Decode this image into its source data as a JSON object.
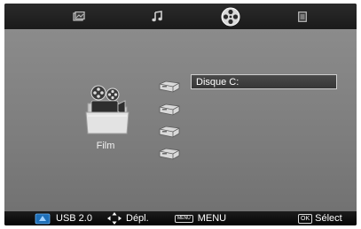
{
  "tabs": [
    {
      "name": "photo",
      "icon": "photo-icon"
    },
    {
      "name": "music",
      "icon": "music-note-icon"
    },
    {
      "name": "movie",
      "icon": "film-reel-icon",
      "selected": true
    },
    {
      "name": "text",
      "icon": "document-icon"
    }
  ],
  "media_type": {
    "label": "Film",
    "icon": "film-folder-icon"
  },
  "drives": [
    {
      "label": "Disque C:",
      "selected": true
    },
    {
      "label": ""
    },
    {
      "label": ""
    },
    {
      "label": ""
    }
  ],
  "footer": {
    "usb_label": "USB 2.0",
    "nav_label": "Dépl.",
    "menu_key": "MENU",
    "menu_label": "MENU",
    "ok_key": "OK",
    "select_label": "Sélect"
  },
  "colors": {
    "accent_selected_tab": "#ffffff",
    "background": "#808080",
    "bar": "#1a1a1a"
  }
}
